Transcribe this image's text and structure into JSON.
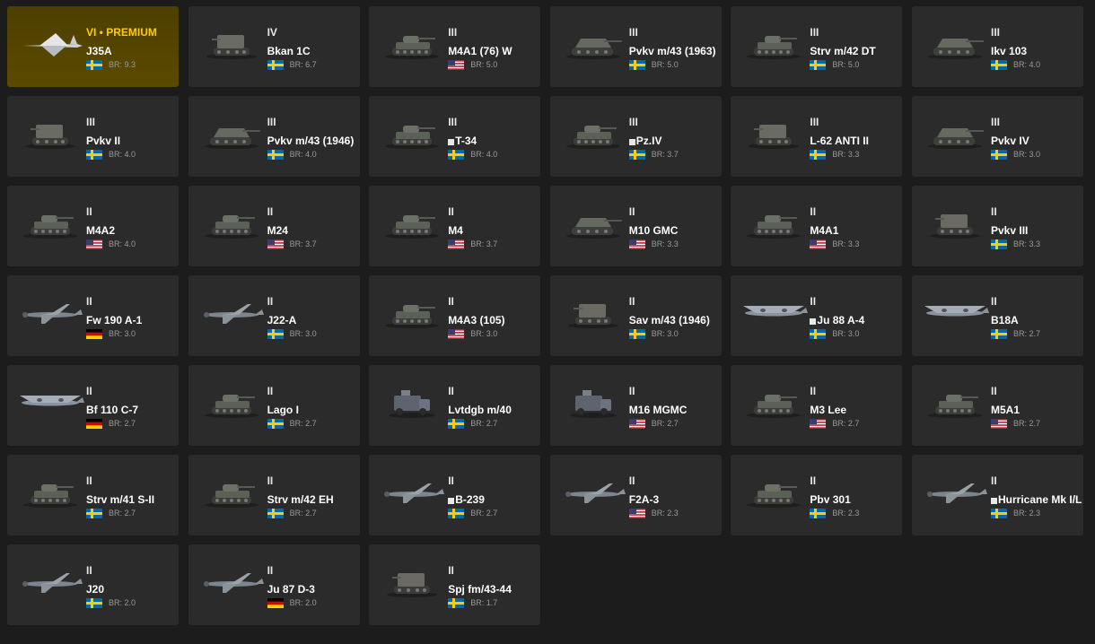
{
  "vehicles": [
    {
      "tier": "VI",
      "premium_label": "PREMIUM",
      "name": "J35A",
      "country": "sweden",
      "br": "BR: 9.3",
      "kind": "jet",
      "premium": true,
      "marker": false
    },
    {
      "tier": "IV",
      "name": "Bkan 1C",
      "country": "sweden",
      "br": "BR: 6.7",
      "kind": "spg",
      "marker": false
    },
    {
      "tier": "III",
      "name": "M4A1 (76) W",
      "country": "usa",
      "br": "BR: 5.0",
      "kind": "tank",
      "marker": false
    },
    {
      "tier": "III",
      "name": "Pvkv m/43 (1963)",
      "country": "sweden",
      "br": "BR: 5.0",
      "kind": "td",
      "marker": false
    },
    {
      "tier": "III",
      "name": "Strv m/42 DT",
      "country": "sweden",
      "br": "BR: 5.0",
      "kind": "tank",
      "marker": false
    },
    {
      "tier": "III",
      "name": "Ikv 103",
      "country": "sweden",
      "br": "BR: 4.0",
      "kind": "td",
      "marker": false
    },
    {
      "tier": "III",
      "name": "Pvkv II",
      "country": "sweden",
      "br": "BR: 4.0",
      "kind": "spg",
      "marker": false
    },
    {
      "tier": "III",
      "name": "Pvkv m/43 (1946)",
      "country": "sweden",
      "br": "BR: 4.0",
      "kind": "td",
      "marker": false
    },
    {
      "tier": "III",
      "name": "T-34",
      "country": "sweden",
      "br": "BR: 4.0",
      "kind": "tank",
      "marker": true
    },
    {
      "tier": "III",
      "name": "Pz.IV",
      "country": "sweden",
      "br": "BR: 3.7",
      "kind": "tank",
      "marker": true
    },
    {
      "tier": "III",
      "name": "L-62 ANTI II",
      "country": "sweden",
      "br": "BR: 3.3",
      "kind": "spg",
      "marker": false
    },
    {
      "tier": "III",
      "name": "Pvkv IV",
      "country": "sweden",
      "br": "BR: 3.0",
      "kind": "td",
      "marker": false
    },
    {
      "tier": "II",
      "name": "M4A2",
      "country": "usa",
      "br": "BR: 4.0",
      "kind": "tank",
      "marker": false
    },
    {
      "tier": "II",
      "name": "M24",
      "country": "usa",
      "br": "BR: 3.7",
      "kind": "tank",
      "marker": false
    },
    {
      "tier": "II",
      "name": "M4",
      "country": "usa",
      "br": "BR: 3.7",
      "kind": "tank",
      "marker": false
    },
    {
      "tier": "II",
      "name": "M10 GMC",
      "country": "usa",
      "br": "BR: 3.3",
      "kind": "td",
      "marker": false
    },
    {
      "tier": "II",
      "name": "M4A1",
      "country": "usa",
      "br": "BR: 3.3",
      "kind": "tank",
      "marker": false
    },
    {
      "tier": "II",
      "name": "Pvkv III",
      "country": "sweden",
      "br": "BR: 3.3",
      "kind": "spg",
      "marker": false
    },
    {
      "tier": "II",
      "name": "Fw 190 A-1",
      "country": "germany",
      "br": "BR: 3.0",
      "kind": "plane",
      "marker": false
    },
    {
      "tier": "II",
      "name": "J22-A",
      "country": "sweden",
      "br": "BR: 3.0",
      "kind": "plane",
      "marker": false
    },
    {
      "tier": "II",
      "name": "M4A3 (105)",
      "country": "usa",
      "br": "BR: 3.0",
      "kind": "tank",
      "marker": false
    },
    {
      "tier": "II",
      "name": "Sav m/43 (1946)",
      "country": "sweden",
      "br": "BR: 3.0",
      "kind": "spg",
      "marker": false
    },
    {
      "tier": "II",
      "name": "Ju 88 A-4",
      "country": "sweden",
      "br": "BR: 3.0",
      "kind": "bomber",
      "marker": true
    },
    {
      "tier": "II",
      "name": "B18A",
      "country": "sweden",
      "br": "BR: 2.7",
      "kind": "bomber",
      "marker": false
    },
    {
      "tier": "II",
      "name": "Bf 110 C-7",
      "country": "germany",
      "br": "BR: 2.7",
      "kind": "bomber",
      "marker": false
    },
    {
      "tier": "II",
      "name": "Lago I",
      "country": "sweden",
      "br": "BR: 2.7",
      "kind": "tank",
      "marker": false
    },
    {
      "tier": "II",
      "name": "Lvtdgb m/40",
      "country": "sweden",
      "br": "BR: 2.7",
      "kind": "truck",
      "marker": false
    },
    {
      "tier": "II",
      "name": "M16 MGMC",
      "country": "usa",
      "br": "BR: 2.7",
      "kind": "truck",
      "marker": false
    },
    {
      "tier": "II",
      "name": "M3 Lee",
      "country": "usa",
      "br": "BR: 2.7",
      "kind": "tank",
      "marker": false
    },
    {
      "tier": "II",
      "name": "M5A1",
      "country": "usa",
      "br": "BR: 2.7",
      "kind": "tank",
      "marker": false
    },
    {
      "tier": "II",
      "name": "Strv m/41 S-II",
      "country": "sweden",
      "br": "BR: 2.7",
      "kind": "tank",
      "marker": false
    },
    {
      "tier": "II",
      "name": "Strv m/42 EH",
      "country": "sweden",
      "br": "BR: 2.7",
      "kind": "tank",
      "marker": false
    },
    {
      "tier": "II",
      "name": "B-239",
      "country": "sweden",
      "br": "BR: 2.7",
      "kind": "plane",
      "marker": true
    },
    {
      "tier": "II",
      "name": "F2A-3",
      "country": "usa",
      "br": "BR: 2.3",
      "kind": "plane",
      "marker": false
    },
    {
      "tier": "II",
      "name": "Pbv 301",
      "country": "sweden",
      "br": "BR: 2.3",
      "kind": "tank",
      "marker": false
    },
    {
      "tier": "II",
      "name": "Hurricane Mk I/L",
      "country": "sweden",
      "br": "BR: 2.3",
      "kind": "plane",
      "marker": true
    },
    {
      "tier": "II",
      "name": "J20",
      "country": "sweden",
      "br": "BR: 2.0",
      "kind": "plane",
      "marker": false
    },
    {
      "tier": "II",
      "name": "Ju 87 D-3",
      "country": "germany",
      "br": "BR: 2.0",
      "kind": "plane",
      "marker": false
    },
    {
      "tier": "II",
      "name": "Spj fm/43-44",
      "country": "sweden",
      "br": "BR: 1.7",
      "kind": "spg",
      "marker": false
    }
  ],
  "colors": {
    "card_bg": "#2b2b2b",
    "premium_bg": "#5a4a00",
    "premium_text": "#ffcc00",
    "br_text": "#9a9a9a",
    "page_bg": "#1c1c1c"
  }
}
